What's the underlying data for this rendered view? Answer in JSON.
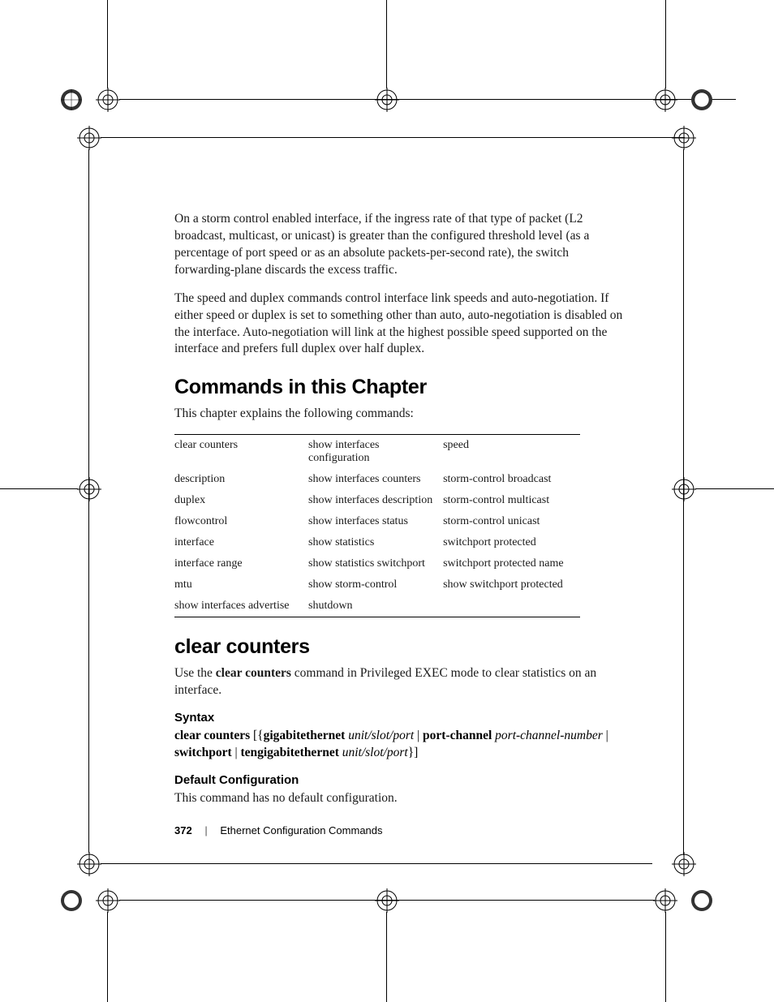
{
  "para1": "On a storm control enabled interface, if the ingress rate of that type of packet (L2 broadcast, multicast, or unicast) is greater than the configured threshold level (as a percentage of port speed or as an absolute packets-per-second rate), the switch forwarding-plane discards the excess traffic.",
  "para2": "The speed and duplex commands control interface link speeds and auto-negotiation. If either speed or duplex is set to something other than auto, auto-negotiation is disabled on the interface. Auto-negotiation will link at the highest possible speed supported on the interface and prefers full duplex over half duplex.",
  "section1": {
    "title": "Commands in this Chapter",
    "intro": "This chapter explains the following commands:"
  },
  "table": {
    "rows": [
      [
        "clear counters",
        "show interfaces configuration",
        "speed"
      ],
      [
        "description",
        "show interfaces counters",
        "storm-control broadcast"
      ],
      [
        "duplex",
        "show interfaces description",
        "storm-control multicast"
      ],
      [
        "flowcontrol",
        "show interfaces status",
        "storm-control unicast"
      ],
      [
        "interface",
        "show statistics",
        "switchport protected"
      ],
      [
        "interface range",
        "show statistics switchport",
        "switchport protected name"
      ],
      [
        "mtu",
        "show storm-control",
        "show switchport protected"
      ],
      [
        "show interfaces advertise",
        "shutdown",
        ""
      ]
    ]
  },
  "section2": {
    "title": "clear counters",
    "intro_pre": "Use the ",
    "intro_cmd": "clear counters",
    "intro_post": " command in Privileged EXEC mode to clear statistics on an interface."
  },
  "syntax": {
    "heading": "Syntax",
    "s1": "clear counters",
    "s2": " [{",
    "s3": "gigabitethernet",
    "s4": " ",
    "s5": "unit/slot/port",
    "s6": " | ",
    "s7": "port-channel",
    "s8": " ",
    "s9": "port-channel-number",
    "s10": " | ",
    "s11": "switchport",
    "s12": " | ",
    "s13": "tengigabitethernet",
    "s14": " ",
    "s15": "unit/slot/port",
    "s16": "}]"
  },
  "defcfg": {
    "heading": "Default Configuration",
    "text": "This command has no default configuration."
  },
  "footer": {
    "page": "372",
    "title": "Ethernet Configuration Commands"
  }
}
